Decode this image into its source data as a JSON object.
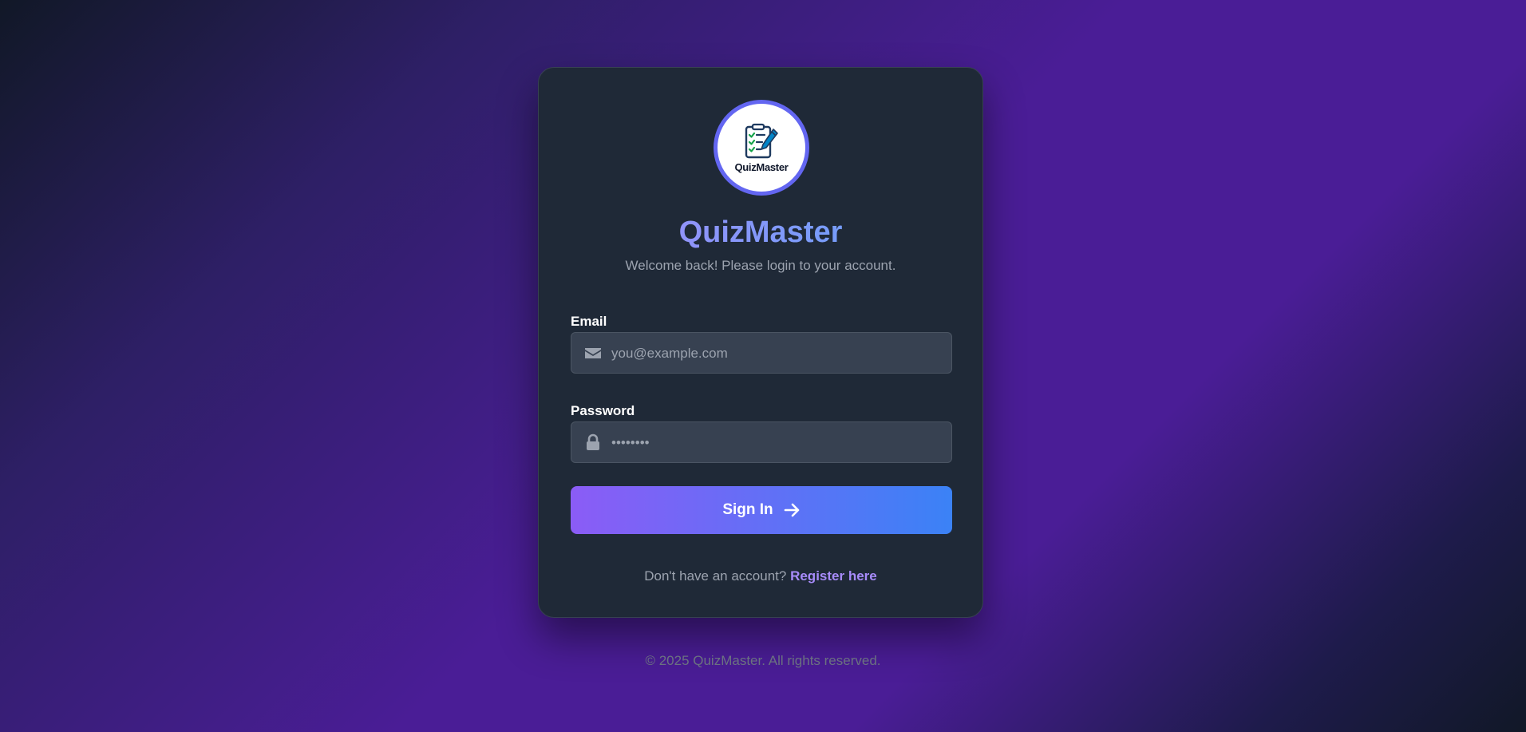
{
  "brand": {
    "name": "QuizMaster",
    "logo_text": "QuizMaster",
    "logo_icon": "checklist-pencil-icon"
  },
  "login": {
    "subtitle": "Welcome back! Please login to your account.",
    "email": {
      "label": "Email",
      "placeholder": "you@example.com",
      "icon": "envelope-icon"
    },
    "password": {
      "label": "Password",
      "placeholder": "••••••••",
      "icon": "lock-icon"
    },
    "submit_label": "Sign In",
    "submit_icon": "arrow-right-icon",
    "register_prompt": "Don't have an account?",
    "register_link": "Register here"
  },
  "footer": {
    "copyright": "© 2025 QuizMaster. All rights reserved."
  },
  "colors": {
    "accent_purple": "#8b5cf6",
    "accent_blue": "#3b82f6",
    "card_bg": "#1f2937",
    "input_bg": "#374151",
    "logo_ring": "#6366f1",
    "link": "#a78bfa"
  }
}
